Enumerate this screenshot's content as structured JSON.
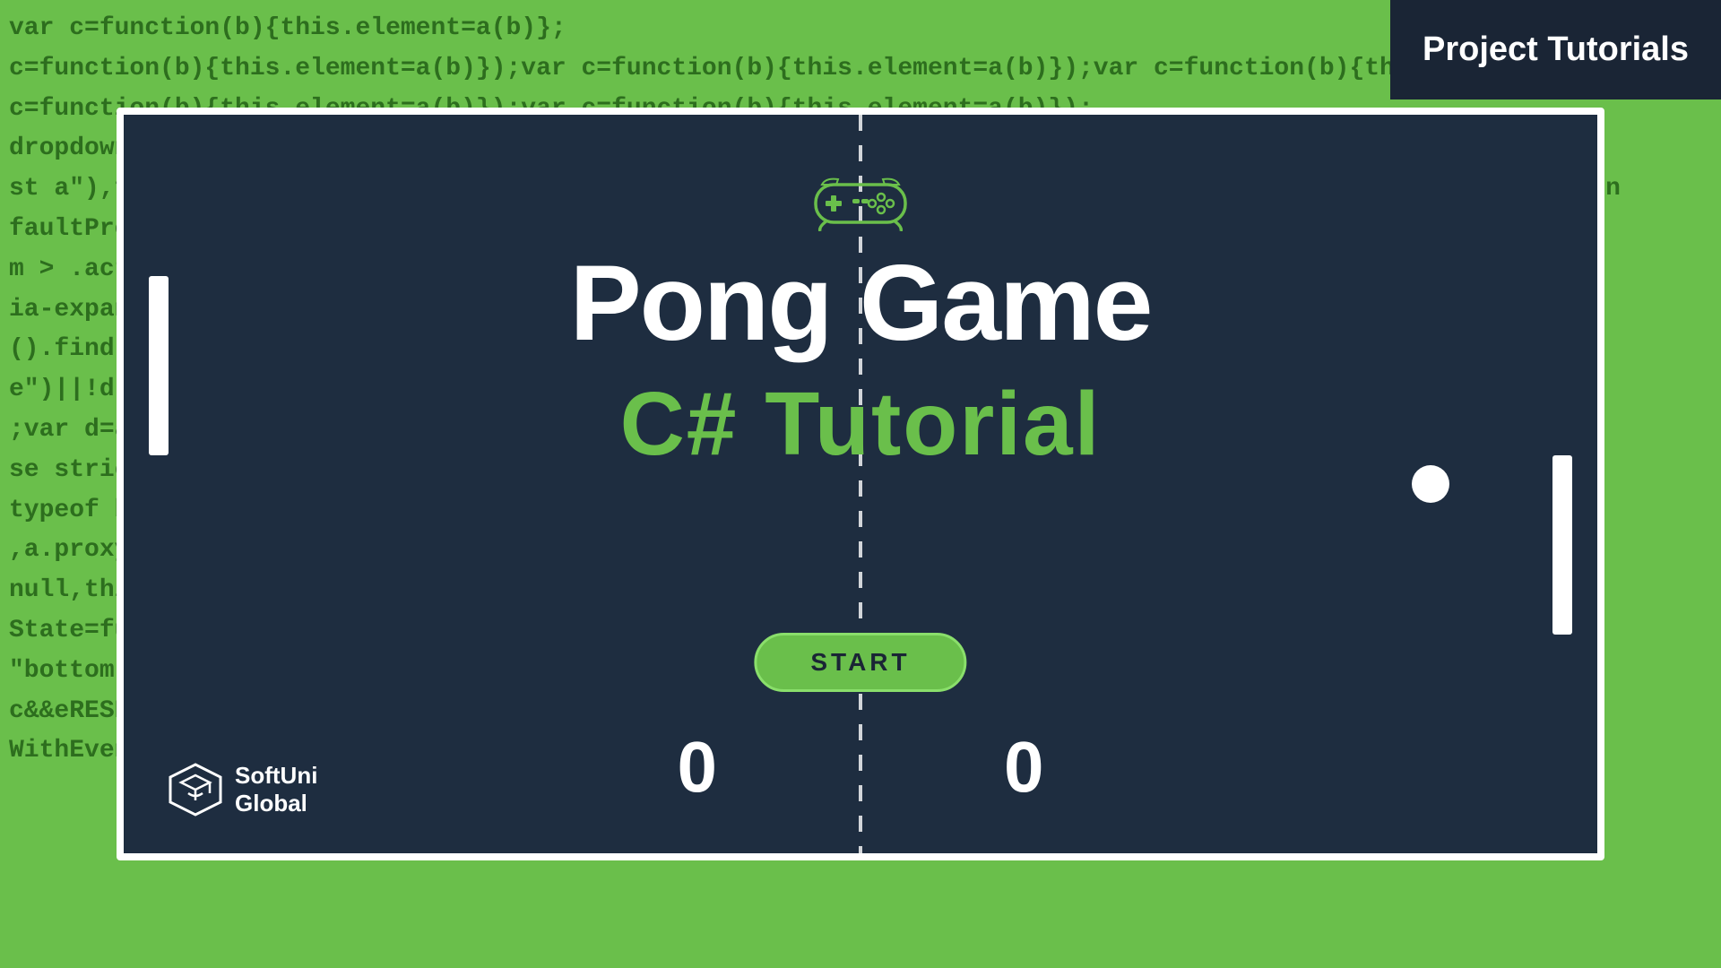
{
  "header": {
    "label": "Project Tutorials"
  },
  "game": {
    "title": "Pong Game",
    "subtitle": "C# Tutorial",
    "start_button": "START",
    "score_left": "0",
    "score_right": "0"
  },
  "logo": {
    "name_line1": "SoftUni",
    "name_line2": "Global"
  },
  "colors": {
    "bg_green": "#6abf4b",
    "card_dark": "#1e2d40",
    "header_dark": "#1a2535",
    "accent_green": "#6abf4b",
    "white": "#ffffff"
  },
  "code_background": "var c=function(b){this.element=a(b)}; dropdown-menu\"),d=b.data(\"target\");if(d||(d=b.attr(\"href\"),d=d&&d.replace(/ *(?=#[^\\s]*).*$/,\" st a\"),f=a.Event(\"hide.bs.tab\",{relatedTarget:b[0]}),g=a.Event(\"show.bs.tab\",{rela faultPreven trigger({ty m > .active ia-expanded ().find('[d e\")||!d.f ;var d=a.fr se strict\" typeof b&& ,a.proxy( null,this. State=func \"bottom\"= c&&e<c c RESET).ad WithEventH ).find('[a data-expan $target.sc StringedOf h.height()  {setTimeout"
}
